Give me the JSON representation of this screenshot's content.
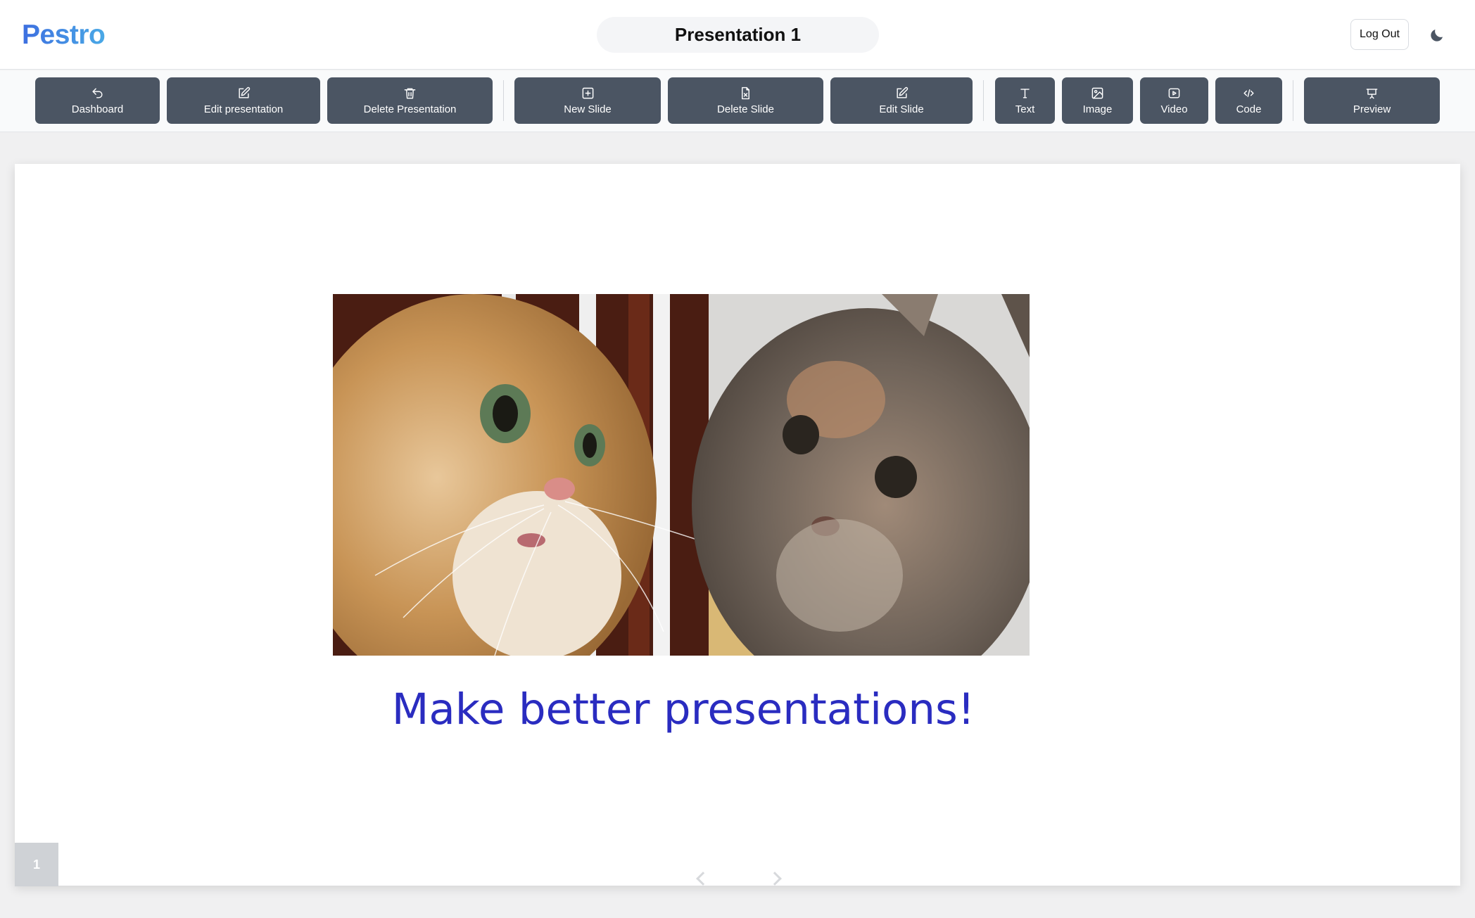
{
  "header": {
    "logo": "Pestro",
    "title": "Presentation 1",
    "logout_label": "Log Out",
    "theme_icon": "moon-icon"
  },
  "toolbar": {
    "dashboard": "Dashboard",
    "edit_presentation": "Edit presentation",
    "delete_presentation": "Delete Presentation",
    "new_slide": "New Slide",
    "delete_slide": "Delete Slide",
    "edit_slide": "Edit Slide",
    "text": "Text",
    "image": "Image",
    "video": "Video",
    "code": "Code",
    "preview": "Preview"
  },
  "slide": {
    "text": "Make better presentations!",
    "number": "1",
    "image_subject": "two cats side by side",
    "text_color": "#2a2cc0"
  },
  "colors": {
    "button_bg": "#4b5563",
    "logo_gradient_start": "#3d6fe0",
    "logo_gradient_end": "#4aa9e6"
  }
}
